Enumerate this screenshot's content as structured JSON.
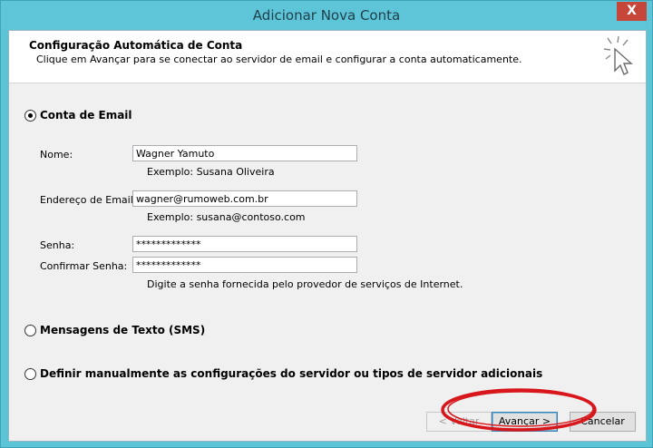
{
  "window": {
    "title": "Adicionar Nova Conta",
    "close_glyph": "X"
  },
  "header": {
    "title": "Configuração Automática de Conta",
    "subtitle": "Clique em Avançar para se conectar ao servidor de email e configurar a conta automaticamente.",
    "icon": "cursor-sparkle-icon"
  },
  "options": {
    "email": {
      "label": "Conta de Email",
      "selected": true
    },
    "sms": {
      "label": "Mensagens de Texto (SMS)",
      "selected": false
    },
    "manual": {
      "label": "Definir manualmente as configurações do servidor ou tipos de servidor adicionais",
      "selected": false
    }
  },
  "form": {
    "name_label": "Nome:",
    "name_value": "Wagner Yamuto",
    "name_hint": "Exemplo: Susana Oliveira",
    "email_label": "Endereço de Email:",
    "email_value": "wagner@rumoweb.com.br",
    "email_hint": "Exemplo: susana@contoso.com",
    "password_label": "Senha:",
    "password_value": "*************",
    "confirm_label": "Confirmar Senha:",
    "confirm_value": "*************",
    "password_hint": "Digite a senha fornecida pelo provedor de serviços de Internet."
  },
  "buttons": {
    "back": "< Voltar",
    "next": "Avançar >",
    "cancel": "Cancelar"
  },
  "colors": {
    "title_bar": "#5ec5d8",
    "close_button": "#c7463a",
    "annotation": "#d8171c"
  }
}
